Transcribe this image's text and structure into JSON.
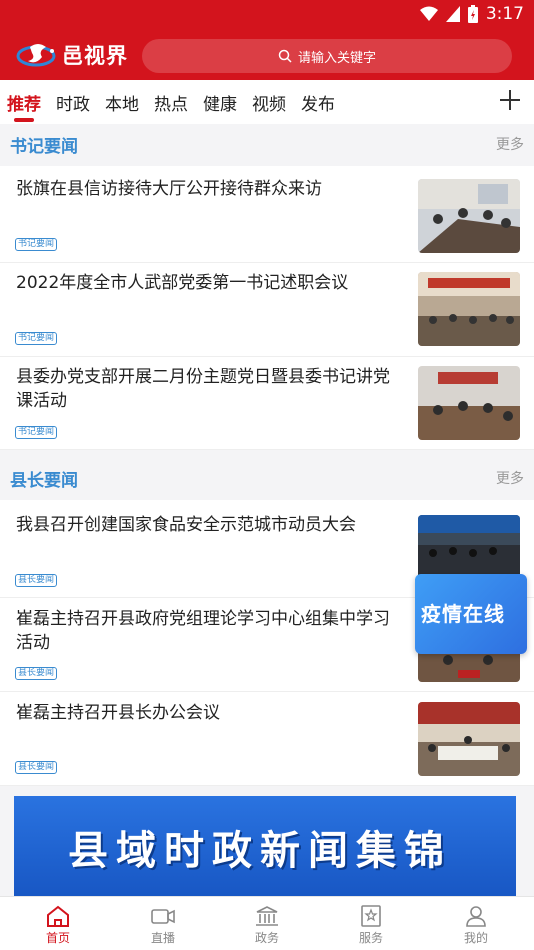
{
  "status_bar": {
    "time": "3:17"
  },
  "app": {
    "name": "邑视界",
    "brand_color": "#d3141d"
  },
  "search": {
    "placeholder": "请输入关键字"
  },
  "tabs": [
    {
      "label": "推荐",
      "active": true
    },
    {
      "label": "时政"
    },
    {
      "label": "本地"
    },
    {
      "label": "热点"
    },
    {
      "label": "健康"
    },
    {
      "label": "视频"
    },
    {
      "label": "发布"
    }
  ],
  "sections": [
    {
      "title": "书记要闻",
      "more": "更多",
      "items": [
        {
          "title": "张旗在县信访接待大厅公开接待群众来访",
          "tag": "书记要闻"
        },
        {
          "title": "2022年度全市人武部党委第一书记述职会议",
          "tag": "书记要闻"
        },
        {
          "title": "县委办党支部开展二月份主题党日暨县委书记讲党课活动",
          "tag": "书记要闻"
        }
      ]
    },
    {
      "title": "县长要闻",
      "more": "更多",
      "items": [
        {
          "title": "我县召开创建国家食品安全示范城市动员大会",
          "tag": "县长要闻"
        },
        {
          "title": "崔磊主持召开县政府党组理论学习中心组集中学习活动",
          "tag": "县长要闻"
        },
        {
          "title": "崔磊主持召开县长办公会议",
          "tag": "县长要闻"
        }
      ]
    }
  ],
  "float_widget": {
    "label": "疫情在线"
  },
  "banner": {
    "text": "县域时政新闻集锦"
  },
  "bottom_nav": [
    {
      "label": "首页",
      "icon": "home-icon",
      "active": true
    },
    {
      "label": "直播",
      "icon": "video-camera-icon"
    },
    {
      "label": "政务",
      "icon": "government-building-icon"
    },
    {
      "label": "服务",
      "icon": "star-bookmark-icon"
    },
    {
      "label": "我的",
      "icon": "user-icon"
    }
  ]
}
